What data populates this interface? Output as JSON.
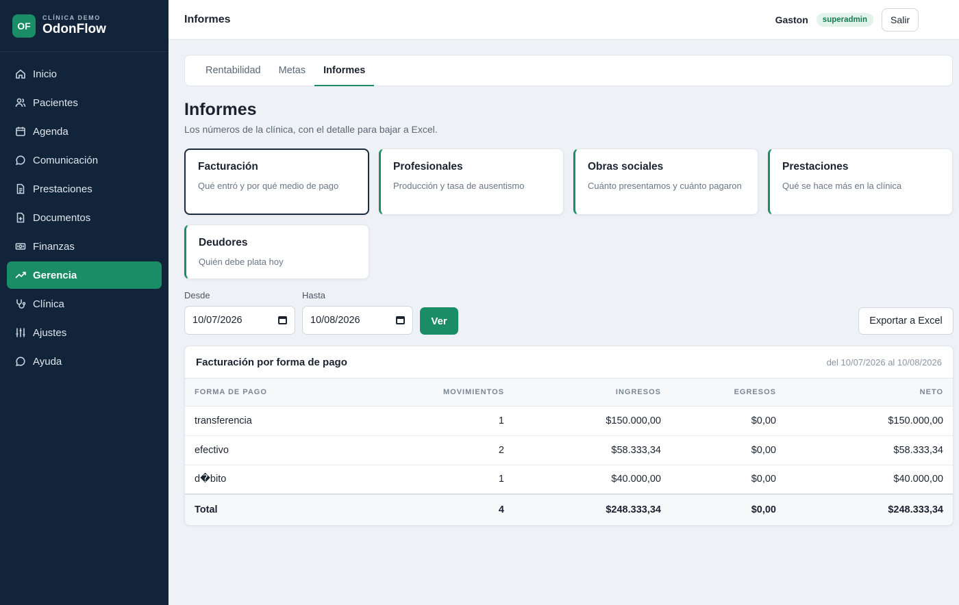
{
  "brand": {
    "logo": "OF",
    "kicker": "CLÍNICA DEMO",
    "name": "OdonFlow"
  },
  "sidebar": {
    "items": [
      {
        "label": "Inicio",
        "icon": "home-icon"
      },
      {
        "label": "Pacientes",
        "icon": "users-icon"
      },
      {
        "label": "Agenda",
        "icon": "calendar-icon"
      },
      {
        "label": "Comunicación",
        "icon": "chat-icon"
      },
      {
        "label": "Prestaciones",
        "icon": "document-icon"
      },
      {
        "label": "Documentos",
        "icon": "file-plus-icon"
      },
      {
        "label": "Finanzas",
        "icon": "money-icon"
      },
      {
        "label": "Gerencia",
        "icon": "trend-up-icon",
        "active": true
      },
      {
        "label": "Clínica",
        "icon": "stethoscope-icon"
      },
      {
        "label": "Ajustes",
        "icon": "sliders-icon"
      },
      {
        "label": "Ayuda",
        "icon": "help-chat-icon"
      }
    ]
  },
  "topbar": {
    "title": "Informes",
    "user": "Gaston",
    "role": "superadmin",
    "logout": "Salir"
  },
  "tabs": [
    {
      "label": "Rentabilidad"
    },
    {
      "label": "Metas"
    },
    {
      "label": "Informes",
      "active": true
    }
  ],
  "page": {
    "title": "Informes",
    "subtitle": "Los números de la clínica, con el detalle para bajar a Excel."
  },
  "reports": [
    {
      "title": "Facturación",
      "desc": "Qué entró y por qué medio de pago",
      "selected": true
    },
    {
      "title": "Profesionales",
      "desc": "Producción y tasa de ausentismo"
    },
    {
      "title": "Obras sociales",
      "desc": "Cuánto presentamos y cuánto pagaron"
    },
    {
      "title": "Prestaciones",
      "desc": "Qué se hace más en la clínica"
    },
    {
      "title": "Deudores",
      "desc": "Quién debe plata hoy"
    }
  ],
  "filters": {
    "desde_label": "Desde",
    "desde_value": "10/07/2026",
    "hasta_label": "Hasta",
    "hasta_value": "10/08/2026",
    "ver": "Ver",
    "export": "Exportar a Excel"
  },
  "table": {
    "title": "Facturación por forma de pago",
    "range": "del 10/07/2026 al 10/08/2026",
    "columns": [
      "FORMA DE PAGO",
      "MOVIMIENTOS",
      "INGRESOS",
      "EGRESOS",
      "NETO"
    ],
    "rows": [
      [
        "transferencia",
        "1",
        "$150.000,00",
        "$0,00",
        "$150.000,00"
      ],
      [
        "efectivo",
        "2",
        "$58.333,34",
        "$0,00",
        "$58.333,34"
      ],
      [
        "d�bito",
        "1",
        "$40.000,00",
        "$0,00",
        "$40.000,00"
      ]
    ],
    "total": [
      "Total",
      "4",
      "$248.333,34",
      "$0,00",
      "$248.333,34"
    ]
  }
}
